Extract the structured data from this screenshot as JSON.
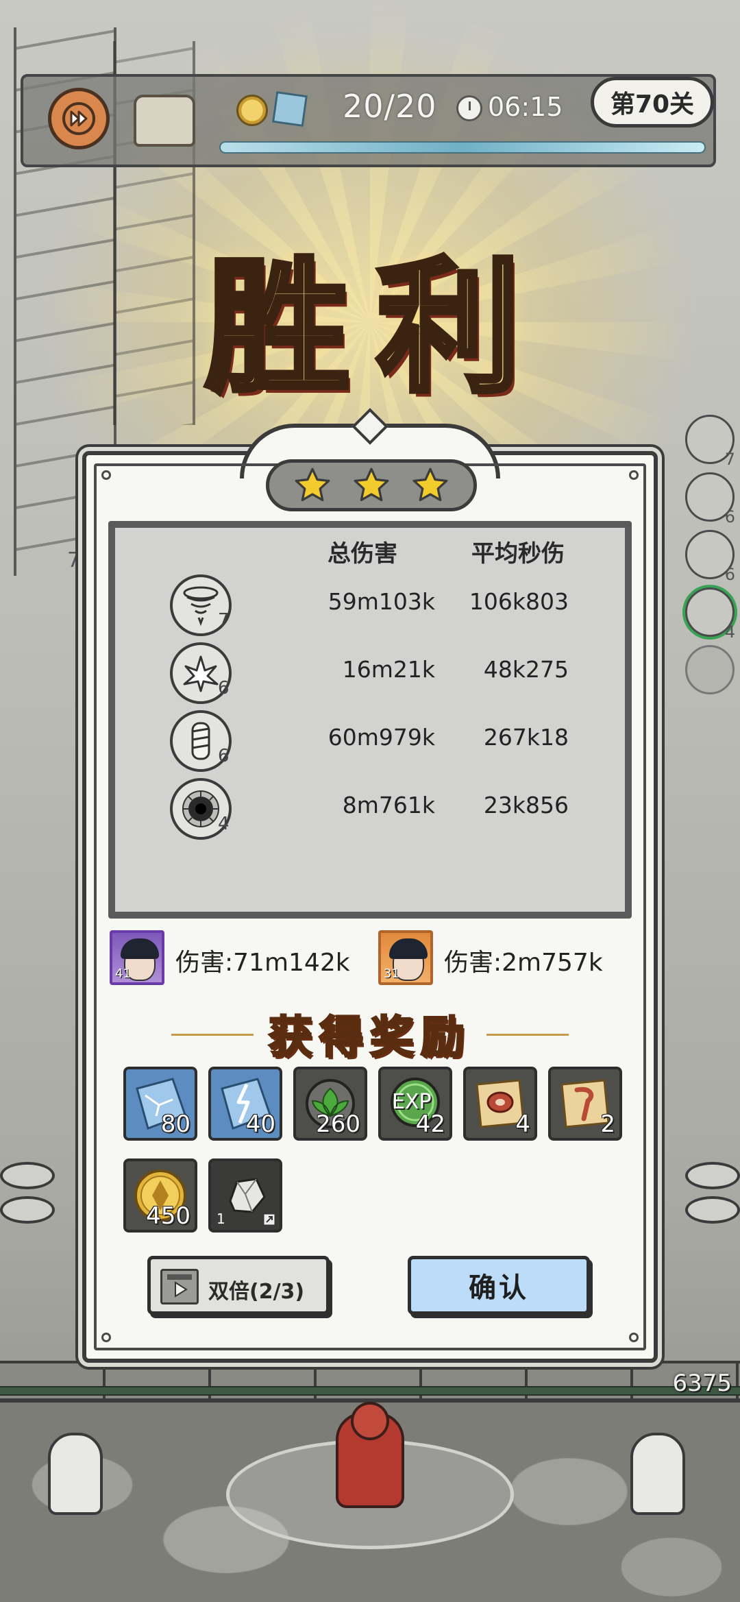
{
  "hud": {
    "wave": "20/20",
    "time": "06:15",
    "level": "第70关"
  },
  "victory_title": "胜利",
  "stars": {
    "earned": 3,
    "max": 3
  },
  "damage_table": {
    "header_total": "总伤害",
    "header_avg": "平均秒伤",
    "rows": [
      {
        "icon": "tornado-skill-icon",
        "level": "7",
        "total": "59m103k",
        "avg": "106k803"
      },
      {
        "icon": "ice-crystal-skill-icon",
        "level": "6",
        "total": "16m21k",
        "avg": "48k275"
      },
      {
        "icon": "whirlwind-pillar-skill-icon",
        "level": "6",
        "total": "60m979k",
        "avg": "267k18"
      },
      {
        "icon": "black-hole-skill-icon",
        "level": "4",
        "total": "8m761k",
        "avg": "23k856"
      }
    ]
  },
  "heroes": [
    {
      "level": "41",
      "damage": "伤害:71m142k",
      "frame_color": "#6a3aa8"
    },
    {
      "level": "31",
      "damage": "伤害:2m757k",
      "frame_color": "#b0652a"
    }
  ],
  "rewards": {
    "title": "获得奖励",
    "items": [
      {
        "icon": "ice-shard-icon",
        "qty": "80"
      },
      {
        "icon": "lightning-ice-shard-icon",
        "qty": "40"
      },
      {
        "icon": "green-leaf-emblem-icon",
        "qty": "260"
      },
      {
        "icon": "exp-orb-icon",
        "qty": "42",
        "text": "EXP"
      },
      {
        "icon": "meat-scroll-icon",
        "qty": "4"
      },
      {
        "icon": "hook-scroll-icon",
        "qty": "2"
      },
      {
        "icon": "gold-coin-icon",
        "qty": "450"
      },
      {
        "icon": "stone-ore-icon",
        "qty": "1"
      }
    ]
  },
  "buttons": {
    "double": "双倍(2/3)",
    "confirm": "确认"
  },
  "side": {
    "skill_levels": [
      "7",
      "6",
      "6",
      "4"
    ],
    "base_hp": "6375",
    "wave_marker": "7"
  },
  "colors": {
    "accent_gold": "#f2cb2d",
    "confirm_blue": "#bcdcf7",
    "reward_title": "#e7a13a"
  }
}
